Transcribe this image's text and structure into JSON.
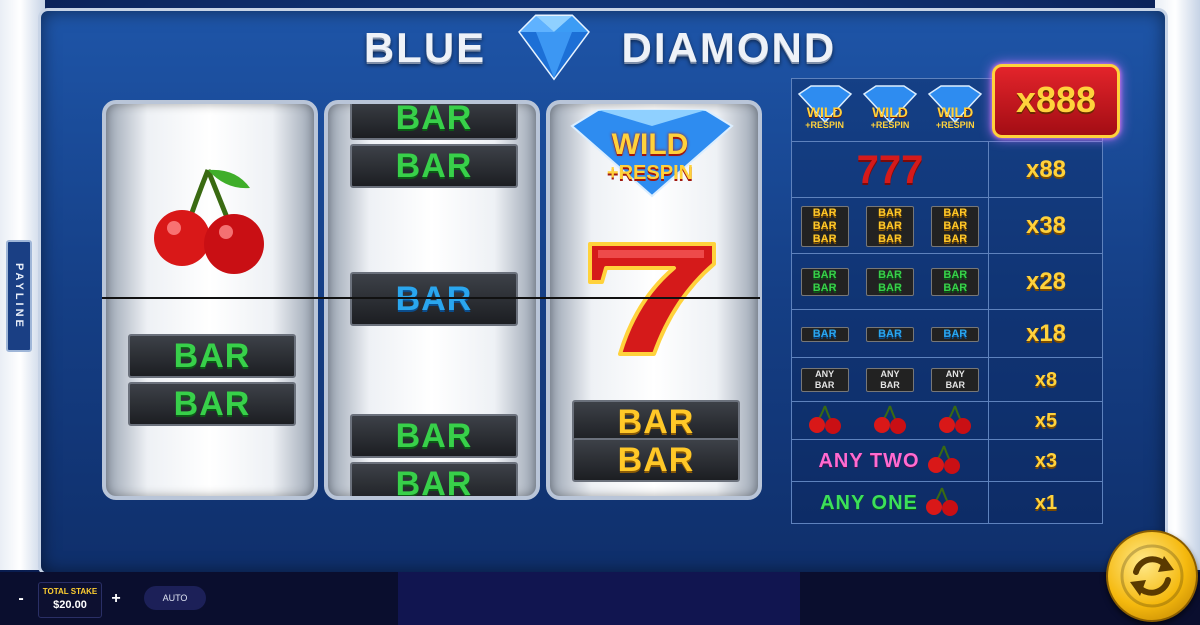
{
  "title": {
    "left": "BLUE",
    "right": "DIAMOND"
  },
  "payline_label": "PAYLINE",
  "reels": {
    "reel1": {
      "bars": [
        "BAR",
        "BAR"
      ]
    },
    "reel2": {
      "top_bars": [
        "BAR",
        "BAR"
      ],
      "center_bar": "BAR",
      "bottom_bars": [
        "BAR",
        "BAR"
      ]
    },
    "reel3": {
      "wild_line1": "WILD",
      "wild_line2": "+RESPIN",
      "bars": [
        "BAR",
        "BAR"
      ]
    }
  },
  "paytable": {
    "top_wild_w": "WILD",
    "top_wild_r": "+RESPIN",
    "top_mult": "x888",
    "rows": [
      {
        "symbol": "777",
        "mult": "x88"
      },
      {
        "symbol": "BAR",
        "mult": "x38"
      },
      {
        "symbol": "BAR",
        "mult": "x28"
      },
      {
        "symbol": "BAR",
        "mult": "x18"
      },
      {
        "symbol": "ANY BAR",
        "mult": "x8"
      },
      {
        "symbol": "cherries",
        "mult": "x5"
      },
      {
        "symbol": "ANY TWO",
        "mult": "x3"
      },
      {
        "symbol": "ANY ONE",
        "mult": "x1"
      }
    ],
    "any_line1": "ANY",
    "any_line2": "BAR"
  },
  "controls": {
    "minus": "-",
    "plus": "+",
    "stake_label": "TOTAL STAKE",
    "stake_value": "$20.00",
    "auto": "AUTO"
  },
  "colors": {
    "bar_green": "#38d04a",
    "bar_blue": "#2aa6ee",
    "bar_gold": "#ffc828",
    "spin": "#f5b90e"
  },
  "icons": {
    "title_gem": "diamond-icon",
    "spin": "spin-arrows-icon",
    "cherry": "cherry-icon",
    "seven": "seven-icon"
  }
}
